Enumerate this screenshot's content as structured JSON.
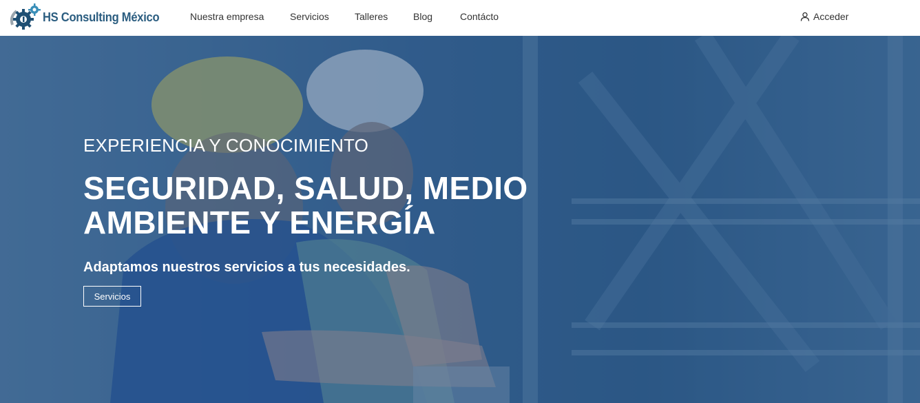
{
  "brand": {
    "name": "HS Consulting México"
  },
  "nav": {
    "items": [
      {
        "label": "Nuestra empresa"
      },
      {
        "label": "Servicios"
      },
      {
        "label": "Talleres"
      },
      {
        "label": "Blog"
      },
      {
        "label": "Contácto"
      }
    ],
    "login_label": "Acceder"
  },
  "hero": {
    "kicker": "EXPERIENCIA Y CONOCIMIENTO",
    "headline_line1": "SEGURIDAD, SALUD, MEDIO",
    "headline_line2": "AMBIENTE Y ENERGÍA",
    "subline": "Adaptamos nuestros servicios a tus necesidades.",
    "button_label": "Servicios"
  },
  "colors": {
    "brand": "#2b5d80",
    "hero_overlay": "#1c4676",
    "text_on_hero": "#ffffff"
  }
}
